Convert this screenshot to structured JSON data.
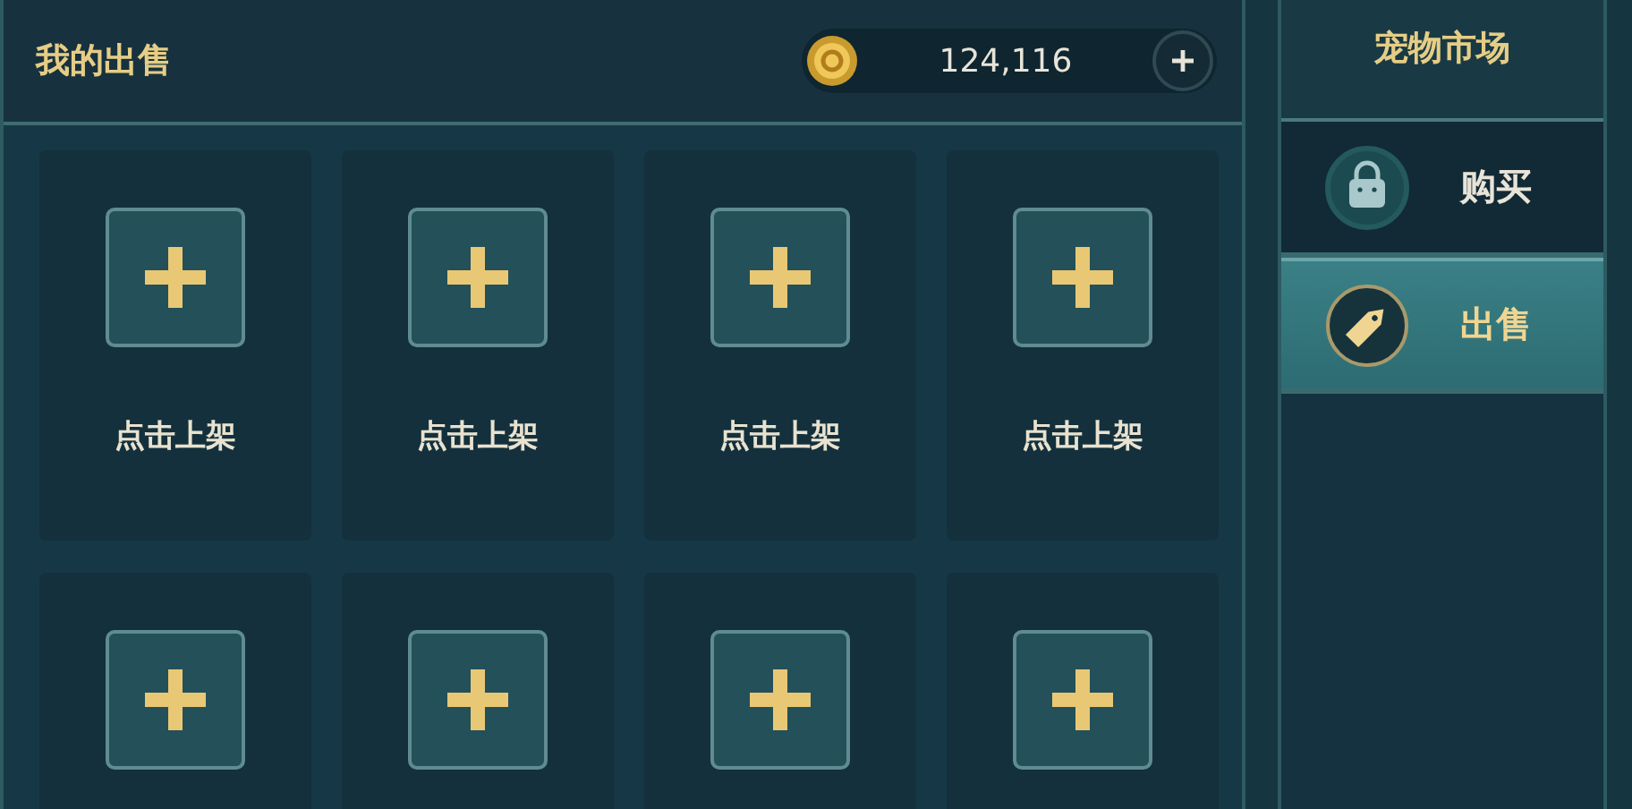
{
  "header": {
    "title": "我的出售",
    "coins": "124,116"
  },
  "slots": [
    {
      "kind": "empty",
      "label": "点击上架"
    },
    {
      "kind": "empty",
      "label": "点击上架"
    },
    {
      "kind": "empty",
      "label": "点击上架"
    },
    {
      "kind": "empty",
      "label": "点击上架"
    },
    {
      "kind": "empty"
    },
    {
      "kind": "empty"
    },
    {
      "kind": "empty"
    },
    {
      "kind": "empty"
    }
  ],
  "sidebar": {
    "title": "宠物市场",
    "tabs": [
      {
        "label": "购买",
        "kind": "buy",
        "selected": false
      },
      {
        "label": "出售",
        "kind": "sell",
        "selected": true
      }
    ]
  }
}
